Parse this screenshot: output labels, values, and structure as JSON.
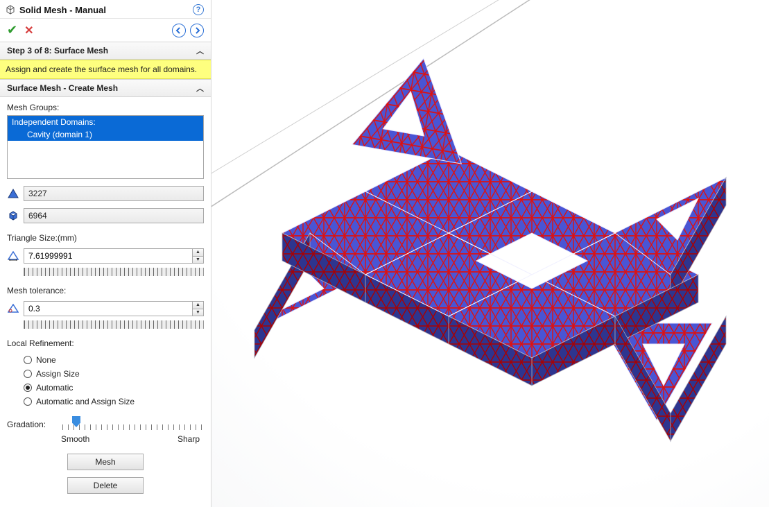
{
  "header": {
    "title": "Solid Mesh - Manual"
  },
  "step": {
    "heading": "Step 3 of 8: Surface Mesh",
    "instruction": "Assign and create the surface mesh for all domains."
  },
  "section": {
    "heading": "Surface Mesh - Create Mesh"
  },
  "mesh_groups": {
    "label": "Mesh Groups:",
    "list_header": "Independent Domains:",
    "items": [
      "Cavity (domain 1)"
    ]
  },
  "counts": {
    "nodes": "3227",
    "elements": "6964"
  },
  "triangle_size": {
    "label": "Triangle Size:(mm)",
    "value": "7.61999991"
  },
  "mesh_tolerance": {
    "label": "Mesh tolerance:",
    "value": "0.3"
  },
  "local_refinement": {
    "label": "Local Refinement:",
    "options": [
      "None",
      "Assign Size",
      "Automatic",
      "Automatic and Assign Size"
    ],
    "selected": "Automatic"
  },
  "gradation": {
    "label": "Gradation:",
    "left": "Smooth",
    "right": "Sharp"
  },
  "buttons": {
    "mesh": "Mesh",
    "delete": "Delete"
  }
}
